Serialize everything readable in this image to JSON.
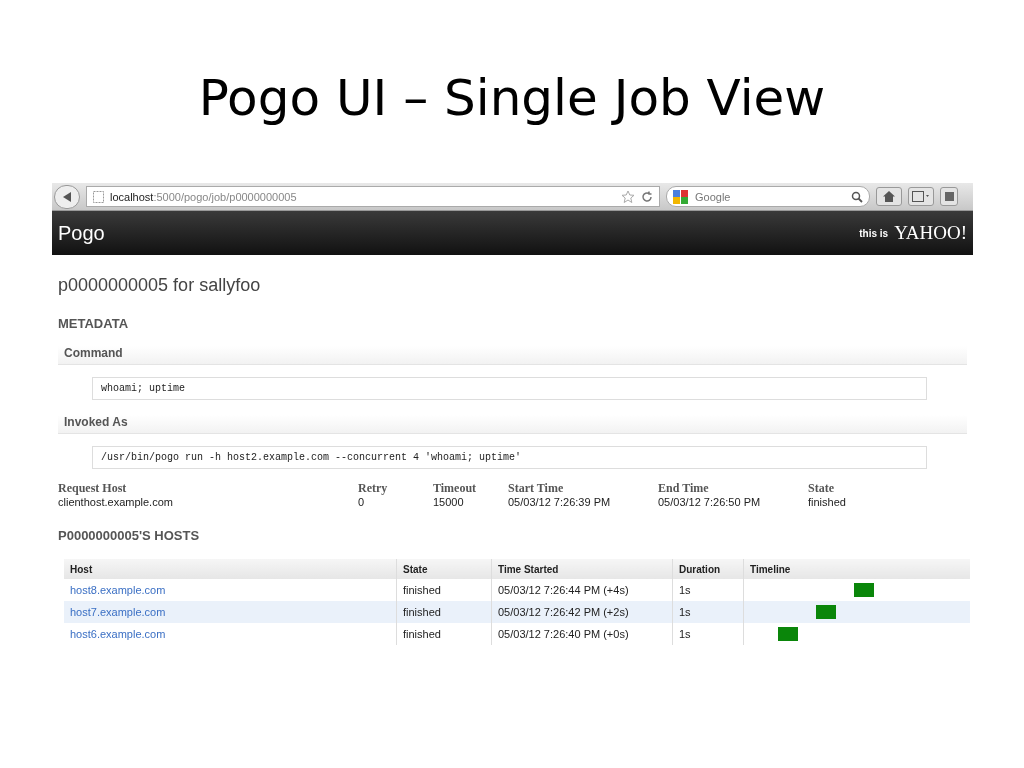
{
  "slide_title": "Pogo UI – Single Job View",
  "browser": {
    "url_host": "localhost",
    "url_path": ":5000/pogo/job/p0000000005",
    "search": {
      "placeholder": "Google"
    }
  },
  "header": {
    "app_name": "Pogo",
    "tagline": "this is",
    "brand": "YAHOO!"
  },
  "page_title": "p0000000005 for sallyfoo",
  "metadata": {
    "heading": "METADATA",
    "sections": [
      {
        "label": "Command",
        "value": "whoami; uptime"
      },
      {
        "label": "Invoked As",
        "value": "/usr/bin/pogo run -h host2.example.com --concurrent 4 'whoami; uptime'"
      }
    ],
    "fields": [
      {
        "label": "Request Host",
        "value": "clienthost.example.com"
      },
      {
        "label": "Retry",
        "value": "0"
      },
      {
        "label": "Timeout",
        "value": "15000"
      },
      {
        "label": "Start Time",
        "value": "05/03/12 7:26:39 PM"
      },
      {
        "label": "End Time",
        "value": "05/03/12 7:26:50 PM"
      },
      {
        "label": "State",
        "value": "finished"
      }
    ]
  },
  "hosts": {
    "heading": "P0000000005'S HOSTS",
    "columns": [
      "Host",
      "State",
      "Time Started",
      "Duration",
      "Timeline"
    ],
    "rows": [
      {
        "host": "host8.example.com",
        "state": "finished",
        "time_started": "05/03/12 7:26:44 PM (+4s)",
        "duration": "1s"
      },
      {
        "host": "host7.example.com",
        "state": "finished",
        "time_started": "05/03/12 7:26:42 PM (+2s)",
        "duration": "1s"
      },
      {
        "host": "host6.example.com",
        "state": "finished",
        "time_started": "05/03/12 7:26:40 PM (+0s)",
        "duration": "1s"
      }
    ]
  }
}
